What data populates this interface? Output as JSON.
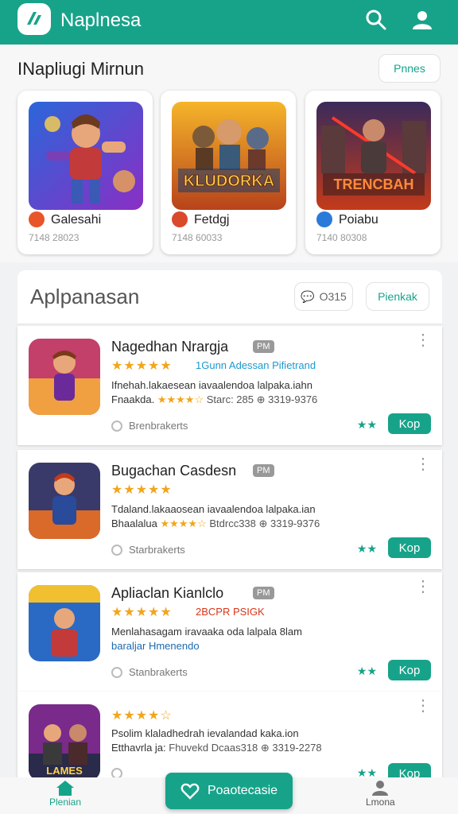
{
  "header": {
    "title": "Naplnesa"
  },
  "featured": {
    "title": "INapliugi Mirnun",
    "button": "Pnnes",
    "cards": [
      {
        "name": "Galesahi",
        "meta": "7148 28023",
        "art_text": ""
      },
      {
        "name": "Fetdgj",
        "meta": "7148 60033",
        "art_text": "KLUDORKA"
      },
      {
        "name": "Poiabu",
        "meta": "7140 80308",
        "art_text": "TRENCBAH"
      }
    ]
  },
  "list": {
    "title": "Aplpanasan",
    "filter_label": "O315",
    "action_label": "Pienkak",
    "apps": [
      {
        "name": "Nagedhan Nrargja",
        "version": "PM",
        "tagline": "1Gunn Adessan Pifietrand",
        "desc_line1": "Ifnehah.lakaesean iavaalendoa lalpaka.iahn",
        "desc_line2_pre": "Fnaakda.",
        "desc_line2_stars": "★★★★☆",
        "desc_line2_post": "Starc: 285 ⊕ 3319-9376",
        "developer": "Brenbrakerts",
        "get": "Kop"
      },
      {
        "name": "Bugachan Casdesn",
        "version": "PM",
        "tagline": "",
        "desc_line1": "Tdaland.lakaaosean iavaalendoa lalpaka.ian",
        "desc_line2_pre": "Bhaalalua",
        "desc_line2_stars": "★★★★☆",
        "desc_line2_post": "Btdrcc338 ⊕ 3319-9376",
        "developer": "Starbrakerts",
        "get": "Kop"
      },
      {
        "name": "Apliaclan Kianlclo",
        "version": "PM",
        "tagline": "2BCPR PSIGK",
        "desc_line1": "Menlahasagam iravaaka oda lalpala 8lam",
        "desc_line2_pre": "baraljar Hmenendo",
        "desc_line2_stars": "",
        "desc_line2_post": "",
        "developer": "Stanbrakerts",
        "get": "Kop"
      },
      {
        "name": "",
        "version": "",
        "tagline": "",
        "desc_line1": "Psolim klaladhedrah ievalandad kaka.ion",
        "desc_line2_pre": "Etthavrla ja:",
        "desc_line2_stars": "",
        "desc_line2_post": "Fhuvekd Dcaas318 ⊕ 3319-2278",
        "developer": "",
        "get": "Kop"
      }
    ]
  },
  "bottom_nav": {
    "home": "Plenian",
    "fab": "Poaotecasie",
    "right": "Lmona"
  },
  "colors": {
    "accent": "#17a38a",
    "star": "#f3a51a",
    "link": "#1b9ad0"
  }
}
